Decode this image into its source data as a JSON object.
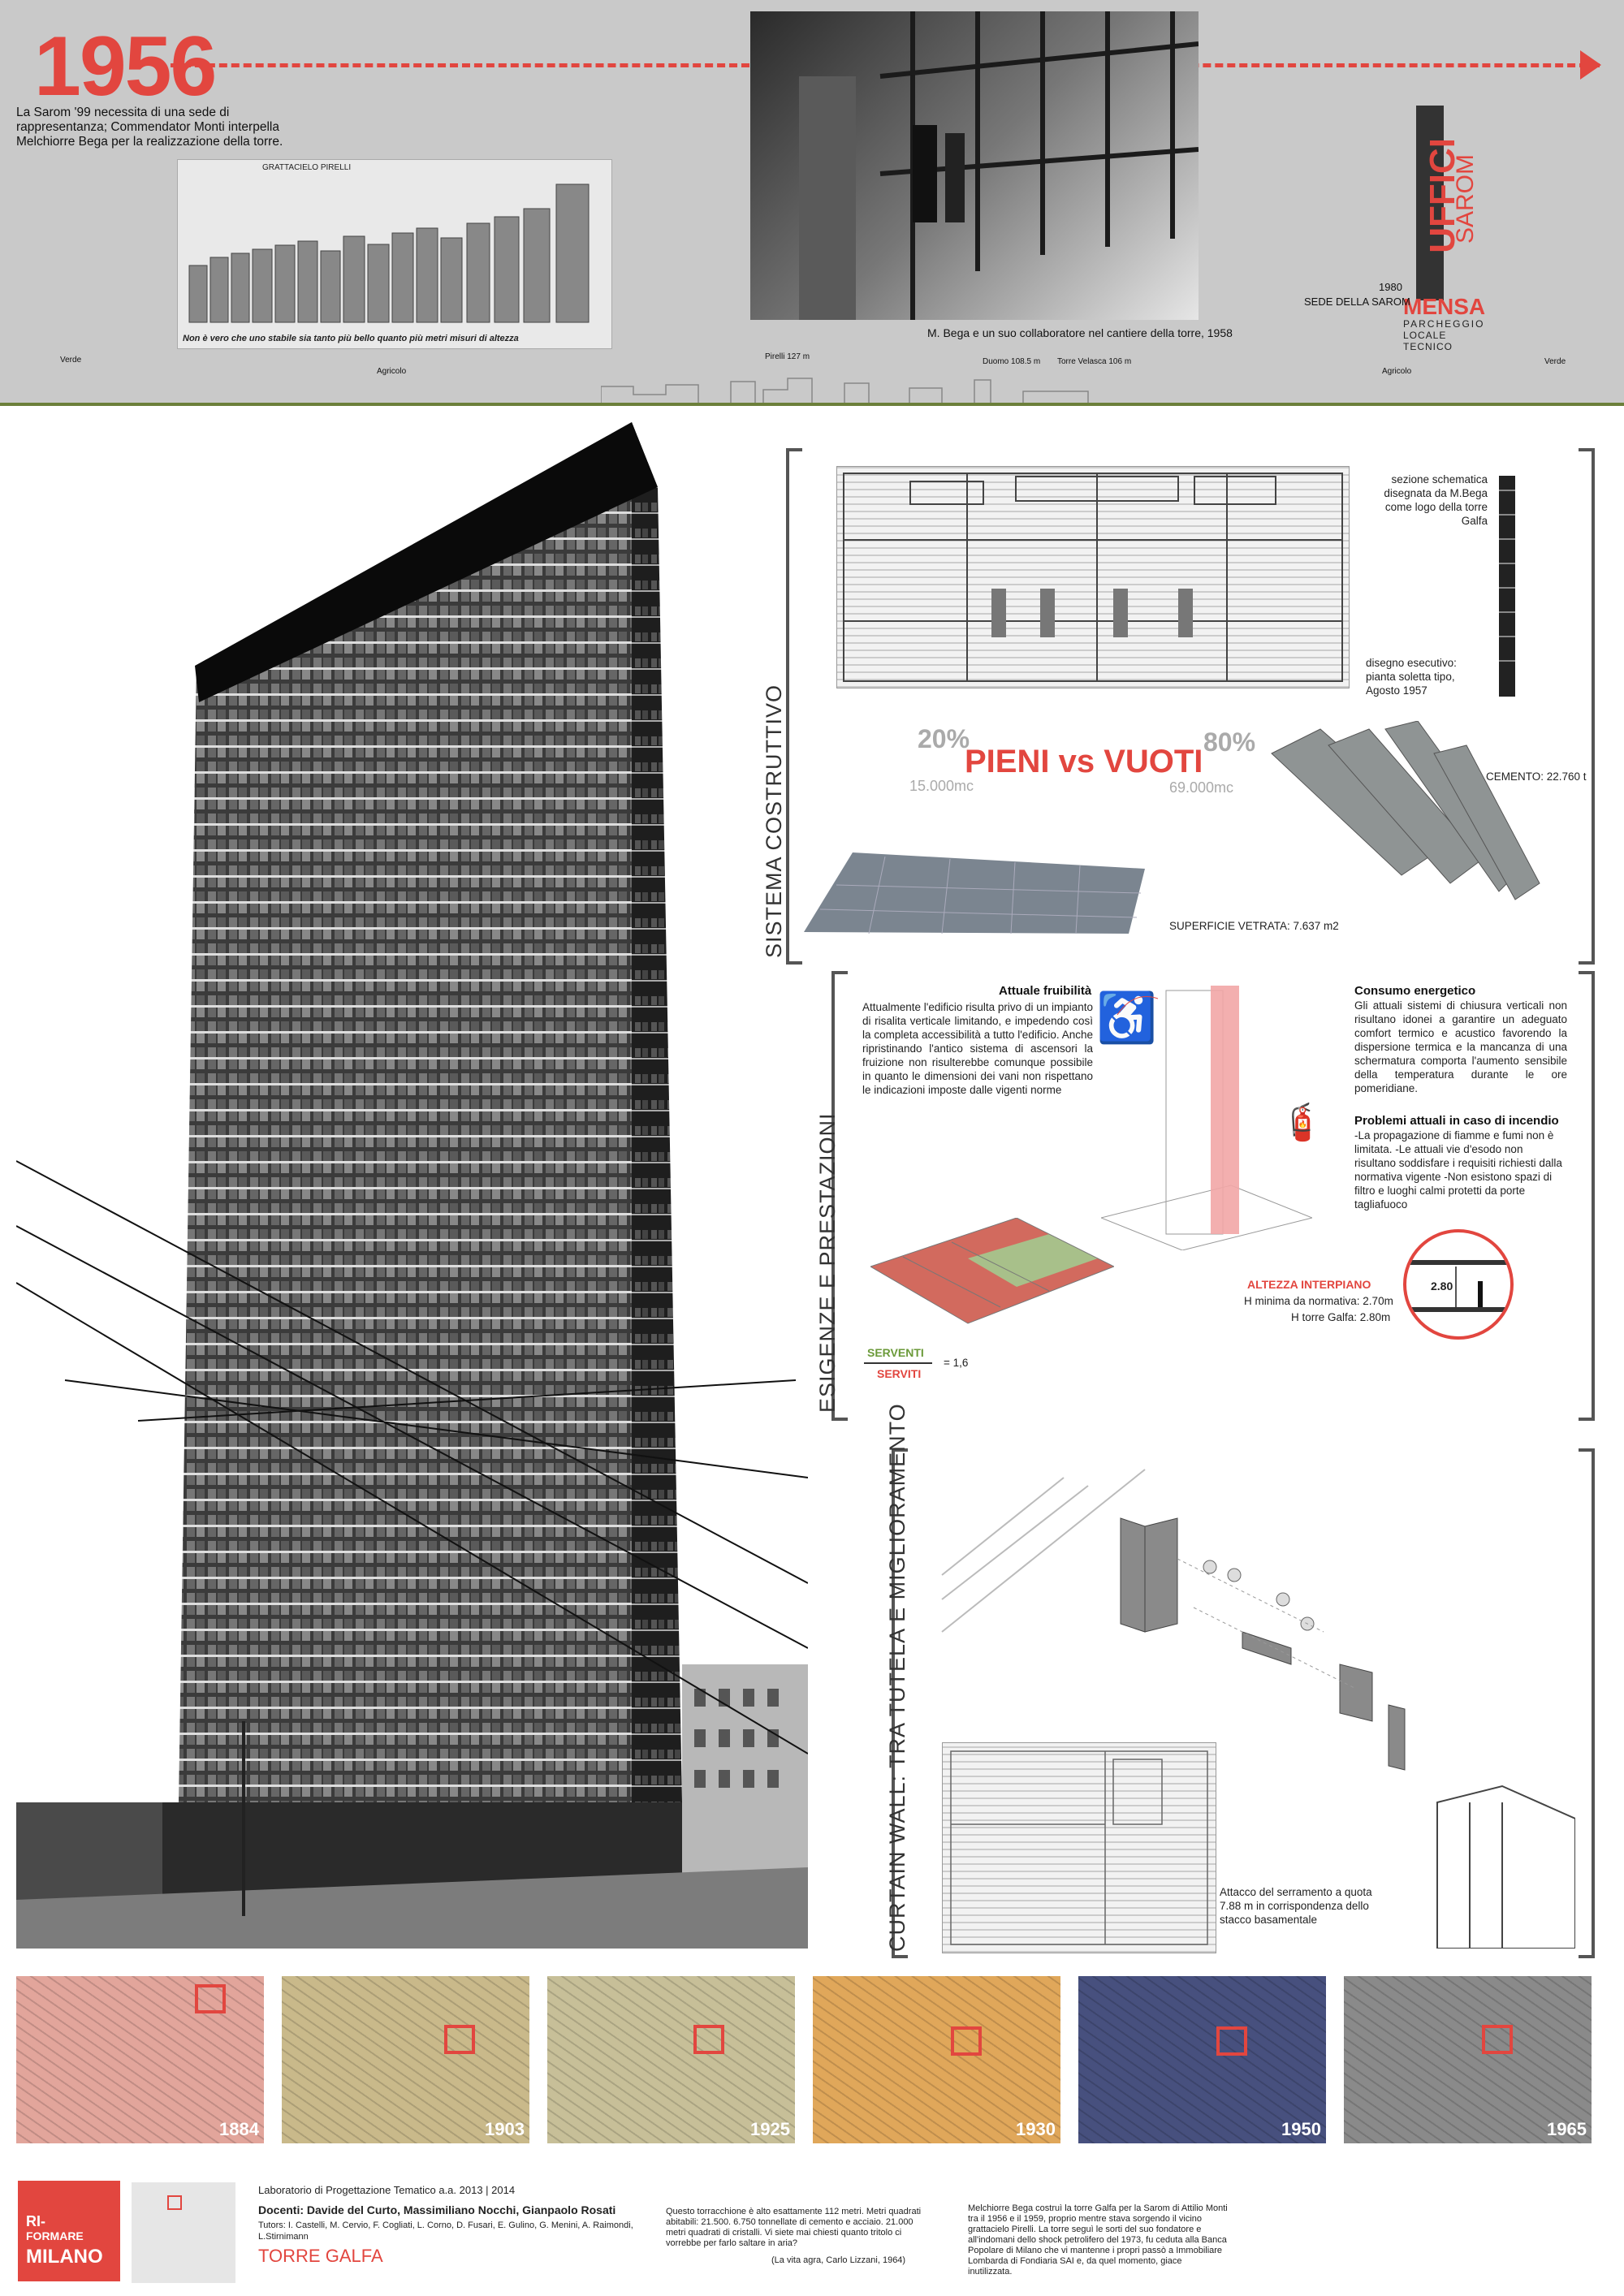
{
  "timeline": {
    "year": "1956",
    "intro": "La Sarom '99 necessita di una sede di rappresentanza; Commendator Monti interpella Melchiorre Bega per la realizzazione della torre.",
    "photo_caption": "M. Bega e un suo collaboratore nel cantiere della torre, 1958",
    "sign_year": "1980",
    "sign_label": "SEDE DELLA SAROM",
    "sign_words": [
      "UFFICI",
      "SAROM",
      "MENSA",
      "PARCHEGGIO",
      "LOCALE TECNICO"
    ],
    "skyline_labels": [
      "Verde",
      "Agricolo",
      "Pirelli 127 m",
      "Duomo 108.5 m",
      "Torre Velasca 106 m",
      "Agricolo",
      "Verde"
    ],
    "clip_header": "GRATTACIELO PIRELLI",
    "clip_caption": "Non è vero che uno stabile sia tanto più bello quanto più metri misuri di altezza"
  },
  "sistema_costruttivo": {
    "title": "SISTEMA COSTRUTTIVO",
    "section_note": "sezione schematica disegnata da M.Bega come logo della torre Galfa",
    "plan_note": "disegno esecutivo: pianta soletta tipo, Agosto 1957",
    "pct_left": "20%",
    "pct_right": "80%",
    "headline": "PIENI vs VUOTI",
    "vol_left": "15.000mc",
    "vol_right": "69.000mc",
    "cemento": "CEMENTO: 22.760 t",
    "superficie": "SUPERFICIE VETRATA: 7.637 m2"
  },
  "esigenze": {
    "title": "ESIGENZE E PRESTAZIONI",
    "fruibilita_head": "Attuale fruibilità",
    "fruibilita_text": "Attualmente l'edificio risulta privo di un impianto di risalita verticale limitando, e impedendo così la completa accessibilità a tutto l'edificio. Anche ripristinando l'antico sistema di ascensori la fruizione non risulterebbe comunque possibile in quanto le dimensioni dei vani non rispettano le indicazioni imposte dalle vigenti norme",
    "consumo_head": "Consumo energetico",
    "consumo_text": "Gli attuali sistemi di chiusura verticali non risultano idonei a garantire un adeguato comfort termico e acustico favorendo la dispersione termica e la mancanza di una schermatura comporta l'aumento sensibile della temperatura durante le ore pomeridiane.",
    "incendio_head": "Problemi attuali in caso di incendio",
    "incendio_text": "-La propagazione di fiamme e fumi non è limitata. -Le attuali vie d'esodo non risultano soddisfare i requisiti richiesti dalla normativa vigente -Non esistono spazi di filtro e luoghi calmi protetti da porte tagliafuoco",
    "serventi": "SERVENTI",
    "serviti": "SERVITI",
    "ratio": "= 1,6",
    "altezza_head": "ALTEZZA INTERPIANO",
    "altezza_min": "H minima da normativa: 2.70m",
    "altezza_galfa": "H torre Galfa: 2.80m",
    "altezza_val": "2.80"
  },
  "curtain_wall": {
    "title": "CURTAIN WALL: TRA TUTELA E MIGLIORAMENTO",
    "caption": "Attacco del serramento a quota 7.88 m in corrispondenza dello stacco basamentale"
  },
  "maps": [
    {
      "year": "1884",
      "tint": "#e2a59b"
    },
    {
      "year": "1903",
      "tint": "#c9b98a"
    },
    {
      "year": "1925",
      "tint": "#c7bf98"
    },
    {
      "year": "1930",
      "tint": "#e0a75a"
    },
    {
      "year": "1950",
      "tint": "#47507e"
    },
    {
      "year": "1965",
      "tint": "#8a8a8a"
    }
  ],
  "footer": {
    "logo_line1": "RI-",
    "logo_line2": "FORMARE",
    "logo_line3": "MILANO",
    "lab": "Laboratorio di Progettazione Tematico a.a. 2013 | 2014",
    "docenti": "Docenti: Davide del Curto, Massimiliano Nocchi, Gianpaolo Rosati",
    "tutors": "Tutors: I. Castelli, M. Cervio, F. Cogliati, L. Corno, D. Fusari, E. Gulino, G. Menini, A. Raimondi, L.Stirnimann",
    "project": "TORRE GALFA",
    "quote": "Questo torracchione è alto esattamente 112 metri. Metri quadrati abitabili: 21.500. 6.750 tonnellate di cemento e acciaio. 21.000 metri quadrati di cristalli. Vi siete mai chiesti quanto tritolo ci vorrebbe per farlo saltare in aria?",
    "quote_source": "(La vita agra, Carlo Lizzani, 1964)",
    "history": "Melchiorre Bega costruì la torre Galfa per la Sarom di Attilio Monti tra il 1956 e il 1959, proprio mentre stava sorgendo il vicino grattacielo Pirelli. La torre seguì le sorti del suo fondatore e all'indomani dello shock petrolifero del 1973, fu ceduta alla Banca Popolare di Milano che vi mantenne i propri passò a Immobiliare Lombarda di Fondiaria SAI e, da quel momento, giace inutilizzata."
  },
  "colors": {
    "accent": "#e2463f",
    "band": "#c9c9c9",
    "green": "#6b9a3a"
  }
}
